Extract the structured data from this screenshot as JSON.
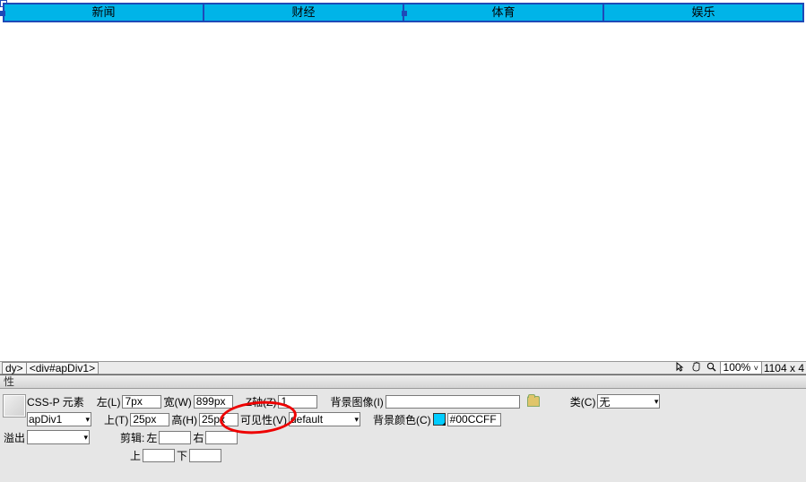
{
  "nav": {
    "items": [
      "新闻",
      "财经",
      "体育",
      "娱乐"
    ]
  },
  "tagbar": {
    "crumb1": "dy>",
    "crumb2": "<div#apDiv1>",
    "zoom": "100%",
    "dims": "1104 x 4"
  },
  "props": {
    "title": "性",
    "r1": {
      "css_p_label": "CSS-P 元素",
      "l_label": "左(L)",
      "l_value": "7px",
      "w_label": "宽(W)",
      "w_value": "899px",
      "z_label": "Z轴(Z)",
      "z_value": "1",
      "bgimg_label": "背景图像(I)",
      "bgimg_value": "",
      "class_label": "类(C)",
      "class_value": "无"
    },
    "r2": {
      "id_value": "apDiv1",
      "t_label": "上(T)",
      "t_value": "25px",
      "h_label": "高(H)",
      "h_value": "25px",
      "vis_label": "可见性(V)",
      "vis_value": "default",
      "bgcolor_label": "背景颜色(C)",
      "bgcolor_value": "#00CCFF",
      "swatch_color": "#00CCFF"
    },
    "r3": {
      "overflow_label": "溢出",
      "overflow_value": "",
      "clip_label": "剪辑:",
      "clip_l_label": "左",
      "clip_r_label": "右",
      "clip_l": "",
      "clip_r": ""
    },
    "r4": {
      "clip_t_label": "上",
      "clip_b_label": "下",
      "clip_t": "",
      "clip_b": ""
    }
  }
}
